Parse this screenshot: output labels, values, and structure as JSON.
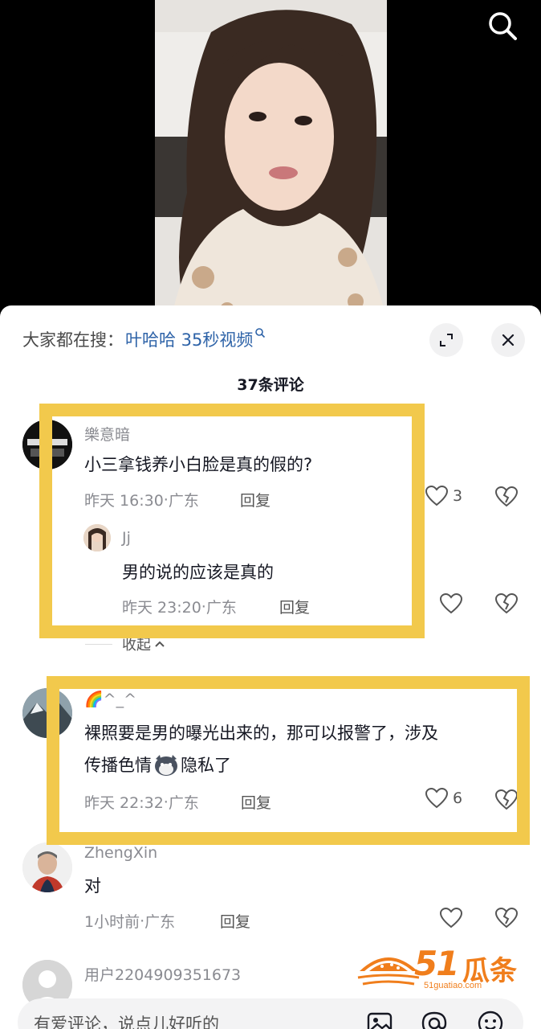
{
  "header": {
    "search_icon": "search-icon"
  },
  "sheet": {
    "trend_prefix": "大家都在搜：",
    "trend_query": "叶哈哈 35秒视频",
    "comment_count": "37条评论"
  },
  "comments": [
    {
      "name": "樂意暗",
      "text": "小三拿钱养小白脸是真的假的?",
      "time": "昨天 16:30",
      "location": "广东",
      "reply_label": "回复",
      "likes": "3"
    },
    {
      "name": "Jj",
      "text": "男的说的应该是真的",
      "time": "昨天 23:20",
      "location": "广东",
      "reply_label": "回复",
      "likes": ""
    },
    {
      "name": "🌈^_^",
      "text_line1": "裸照要是男的曝光出来的，那可以报警了，涉及",
      "text_line2a": "传播色情",
      "text_line2b": "隐私了",
      "time": "昨天 22:32",
      "location": "广东",
      "reply_label": "回复",
      "likes": "6"
    },
    {
      "name": "ZhengXin",
      "text": "对",
      "time": "1小时前",
      "location": "广东",
      "reply_label": "回复",
      "likes": ""
    },
    {
      "name": "用户2204909351673"
    }
  ],
  "collapse_label": "收起",
  "input": {
    "placeholder": "有爱评论，说点儿好听的"
  },
  "watermark": {
    "brand": "51",
    "brand_cn": "瓜条",
    "url": "51guatiao.com"
  },
  "colors": {
    "highlight": "#f2c94c",
    "link": "#2e63a8",
    "watermark": "#f07e1c"
  }
}
